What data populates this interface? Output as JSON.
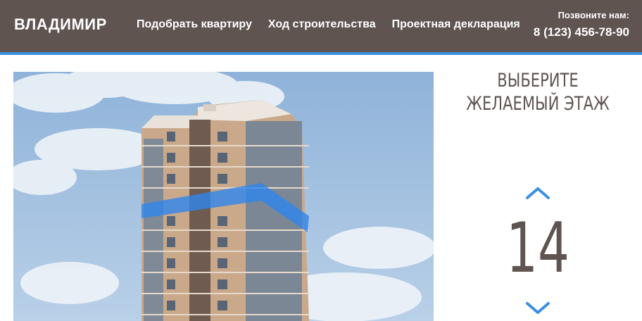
{
  "header": {
    "logo": "ВЛАДИМИР",
    "nav": [
      {
        "label": "Подобрать квартиру"
      },
      {
        "label": "Ход строительства"
      },
      {
        "label": "Проектная декларация"
      }
    ],
    "phone_label": "Позвоните нам:",
    "phone": "8 (123) 456-78-90"
  },
  "floor_selector": {
    "title": "ВЫБЕРИТЕ ЖЕЛАЕМЫЙ ЭТАЖ",
    "selected_floor": "14",
    "up_icon": "chevron-up-icon",
    "down_icon": "chevron-down-icon"
  },
  "colors": {
    "header_bg": "#5f5450",
    "accent": "#3b8fe2",
    "text_dark": "#5f5450"
  }
}
